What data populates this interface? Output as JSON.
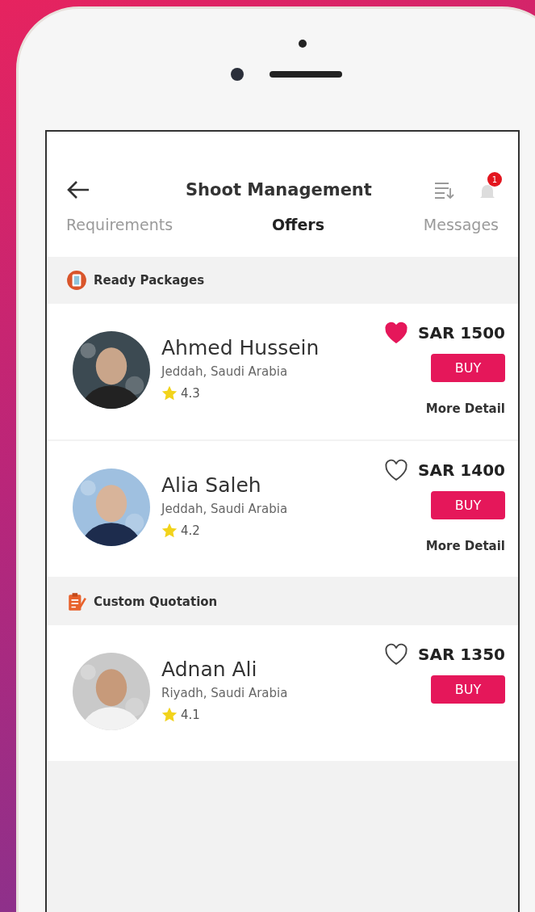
{
  "header": {
    "title": "Shoot Management",
    "notification_count": "1"
  },
  "tabs": [
    {
      "label": "Requirements",
      "selected": false
    },
    {
      "label": "Offers",
      "selected": true
    },
    {
      "label": "Messages",
      "selected": false
    }
  ],
  "sections": [
    {
      "kind": "packages",
      "title": "Ready Packages",
      "offers": [
        {
          "name": "Ahmed Hussein",
          "location": "Jeddah, Saudi Arabia",
          "rating": "4.3",
          "price": "SAR 1500",
          "favorite": true,
          "buy": "BUY",
          "more": "More Detail"
        },
        {
          "name": "Alia Saleh",
          "location": "Jeddah, Saudi Arabia",
          "rating": "4.2",
          "price": "SAR 1400",
          "favorite": false,
          "buy": "BUY",
          "more": "More Detail"
        }
      ]
    },
    {
      "kind": "quotation",
      "title": "Custom Quotation",
      "offers": [
        {
          "name": "Adnan Ali",
          "location": "Riyadh, Saudi Arabia",
          "rating": "4.1",
          "price": "SAR 1350",
          "favorite": false,
          "buy": "BUY"
        }
      ]
    }
  ]
}
